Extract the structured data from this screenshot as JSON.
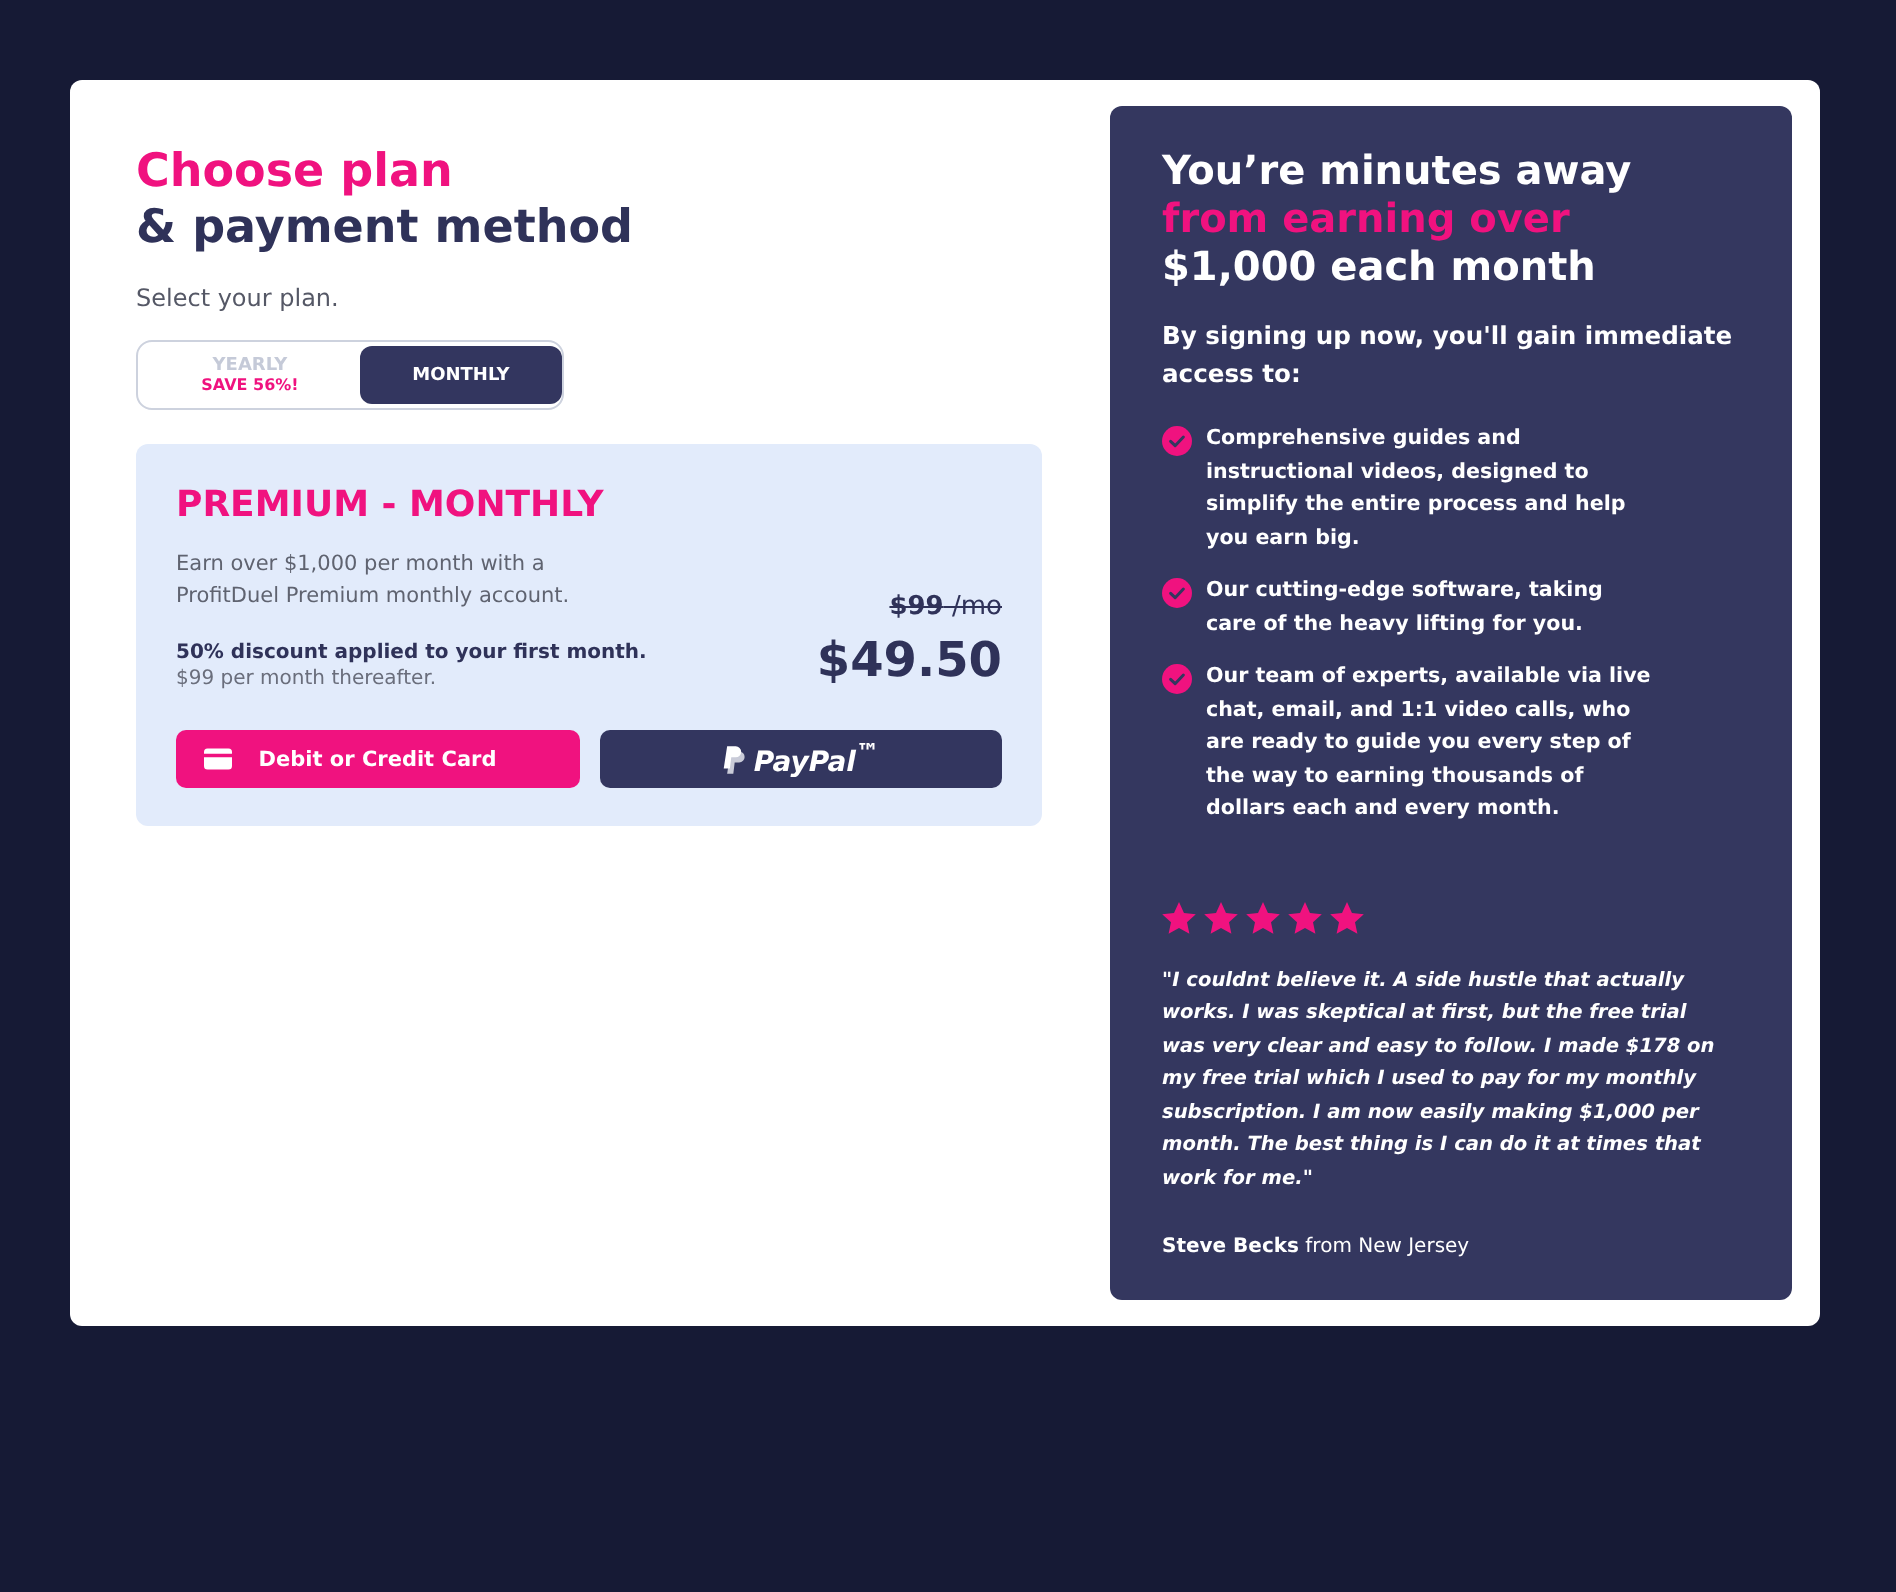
{
  "heading": [
    {
      "text": "Choose plan",
      "highlight": true
    },
    {
      "text": "& payment method",
      "highlight": false
    }
  ],
  "subtitle": "Select your plan.",
  "billing_toggle": [
    {
      "label": "YEARLY",
      "note": "SAVE 56%!",
      "selected": false
    },
    {
      "label": "MONTHLY",
      "selected": true
    }
  ],
  "plan": {
    "title": "PREMIUM - MONTHLY",
    "description": "Earn over $1,000 per month with a ProfitDuel Premium monthly account.",
    "discount": "50% discount applied to your first month.",
    "renewal": "$99 per month thereafter.",
    "old_price": "**$99** /mo",
    "price": "$49.50"
  },
  "payment_buttons": [
    {
      "kind": "card",
      "label": "Debit or Credit Card"
    },
    {
      "kind": "paypal",
      "label": "PayPal$^{™}$"
    }
  ],
  "promo": {
    "heading": [
      {
        "text": "You’re minutes away",
        "highlight": false
      },
      {
        "text": "from earning over",
        "highlight": true
      },
      {
        "text": "$1,000 each month",
        "highlight": false
      }
    ],
    "intro": "By signing up now, you'll gain immediate access to:",
    "benefits": [
      "Comprehensive guides and instructional videos, designed to simplify the entire process and help you earn big.",
      "Our cutting-edge software, taking care of the heavy lifting for you.",
      "Our team of experts, available via live chat, email, and 1:1 video calls, who are ready to guide you every step of the way to earning thousands of dollars each and every month."
    ],
    "review": {
      "stars": 5,
      "quote": "\"I couldnt believe it. A side hustle that actually works. I was skeptical at first, but the free trial was very clear and easy to follow. I made $178 on my free trial which I used to pay for my monthly subscription. I am now easily making $1,000 per month. The best thing is I can do it at times that work for me.\"",
      "author": "**Steve Becks** from New Jersey"
    }
  }
}
